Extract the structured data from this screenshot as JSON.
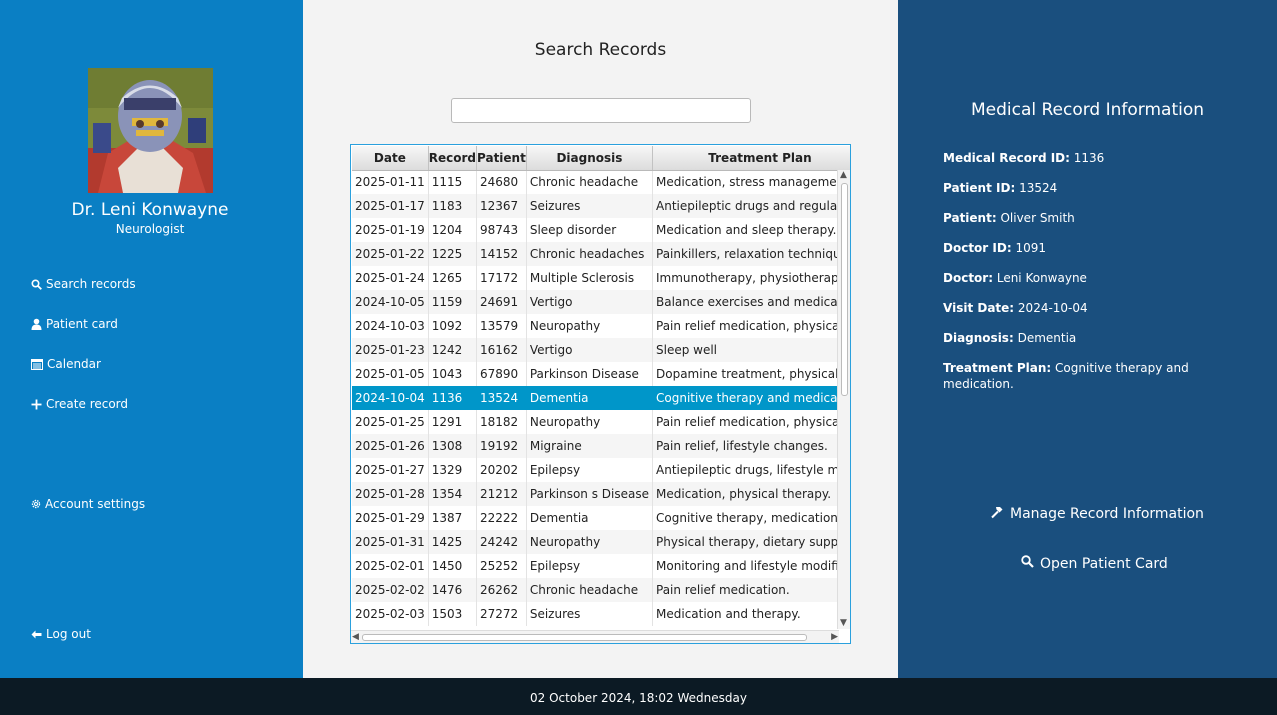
{
  "doctor": {
    "name": "Dr. Leni Konwayne",
    "role": "Neurologist"
  },
  "nav": {
    "search_records": "Search records",
    "patient_card": "Patient card",
    "calendar": "Calendar",
    "create_record": "Create record",
    "account_settings": "Account settings",
    "log_out": "Log out"
  },
  "main": {
    "title": "Search Records",
    "search_value": "",
    "columns": [
      "Date",
      "Record",
      "Patient",
      "Diagnosis",
      "Treatment Plan"
    ],
    "selected_row": 9,
    "rows": [
      [
        "2025-01-11",
        "1115",
        "24680",
        "Chronic headache",
        "Medication, stress management, a"
      ],
      [
        "2025-01-17",
        "1183",
        "12367",
        "Seizures",
        "Antiepileptic drugs and regular m"
      ],
      [
        "2025-01-19",
        "1204",
        "98743",
        "Sleep disorder",
        "Medication and sleep therapy."
      ],
      [
        "2025-01-22",
        "1225",
        "14152",
        "Chronic headaches",
        "Painkillers, relaxation techniques."
      ],
      [
        "2025-01-24",
        "1265",
        "17172",
        "Multiple Sclerosis",
        "Immunotherapy, physiotherapy."
      ],
      [
        "2024-10-05",
        "1159",
        "24691",
        "Vertigo",
        "Balance exercises and medication"
      ],
      [
        "2024-10-03",
        "1092",
        "13579",
        "Neuropathy",
        "Pain relief medication, physical th"
      ],
      [
        "2025-01-23",
        "1242",
        "16162",
        "Vertigo",
        "Sleep well"
      ],
      [
        "2025-01-05",
        "1043",
        "67890",
        "Parkinson Disease",
        "Dopamine treatment, physical the"
      ],
      [
        "2024-10-04",
        "1136",
        "13524",
        "Dementia",
        "Cognitive therapy and medication"
      ],
      [
        "2025-01-25",
        "1291",
        "18182",
        "Neuropathy",
        "Pain relief medication, physical th"
      ],
      [
        "2025-01-26",
        "1308",
        "19192",
        "Migraine",
        "Pain relief, lifestyle changes."
      ],
      [
        "2025-01-27",
        "1329",
        "20202",
        "Epilepsy",
        "Antiepileptic drugs, lifestyle modi"
      ],
      [
        "2025-01-28",
        "1354",
        "21212",
        "Parkinson s Disease",
        "Medication, physical therapy."
      ],
      [
        "2025-01-29",
        "1387",
        "22222",
        "Dementia",
        "Cognitive therapy, medication."
      ],
      [
        "2025-01-31",
        "1425",
        "24242",
        "Neuropathy",
        "Physical therapy, dietary supplem"
      ],
      [
        "2025-02-01",
        "1450",
        "25252",
        "Epilepsy",
        "Monitoring and lifestyle modificat"
      ],
      [
        "2025-02-02",
        "1476",
        "26262",
        "Chronic headache",
        "Pain relief medication."
      ],
      [
        "2025-02-03",
        "1503",
        "27272",
        "Seizures",
        "Medication and therapy."
      ]
    ]
  },
  "record": {
    "title": "Medical Record Information",
    "fields": [
      {
        "label": "Medical Record ID:",
        "value": "1136"
      },
      {
        "label": "Patient ID:",
        "value": "13524"
      },
      {
        "label": "Patient:",
        "value": "Oliver Smith"
      },
      {
        "label": "Doctor ID:",
        "value": "1091"
      },
      {
        "label": "Doctor:",
        "value": "Leni Konwayne"
      },
      {
        "label": "Visit Date:",
        "value": "2024-10-04"
      },
      {
        "label": "Diagnosis:",
        "value": "Dementia"
      },
      {
        "label": "Treatment Plan:",
        "value": "Cognitive therapy and medication."
      }
    ],
    "manage_label": "Manage Record Information",
    "open_card_label": "Open Patient Card"
  },
  "footer": {
    "datetime": "02 October 2024, 18:02 Wednesday"
  },
  "colors": {
    "sidebar": "#0a7fc4",
    "right_panel": "#1a4f7e",
    "selected_row": "#0096c9",
    "footer": "#0c1a24"
  }
}
